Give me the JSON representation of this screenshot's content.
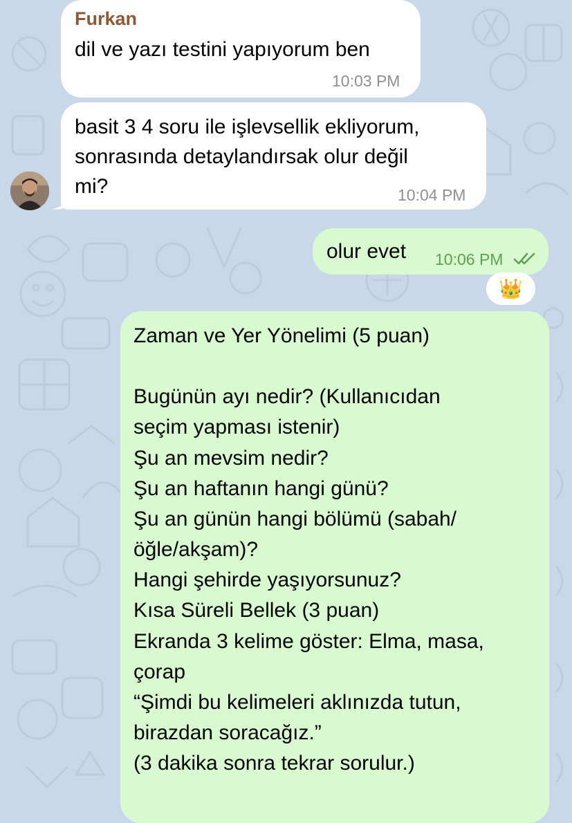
{
  "messages": [
    {
      "sender": "Furkan",
      "text": "dil ve yazı testini yapıyorum ben",
      "time": "10:03 PM"
    },
    {
      "text": "basit 3 4 soru ile işlevsellik ekliyorum,\nsonrasında detaylandırsak olur değil\nmi?",
      "time": "10:04 PM"
    },
    {
      "text": "olur evet",
      "time": "10:06 PM",
      "reaction": "👑"
    },
    {
      "text": "Zaman ve Yer Yönelimi (5 puan)\n\nBugünün ayı nedir? (Kullanıcıdan\nseçim yapması istenir)\nŞu an mevsim nedir?\nŞu an haftanın hangi günü?\nŞu an günün hangi bölümü (sabah/\nöğle/akşam)?\nHangi şehirde yaşıyorsunuz?\nKısa Süreli Bellek (3 puan)\nEkranda 3 kelime göster: Elma, masa,\nçorap\n“Şimdi bu kelimeleri aklınızda tutun,\nbirazdan soracağız.”\n(3 dakika sonra tekrar sorulur.)"
    }
  ],
  "colors": {
    "background": "#c9d8e9",
    "incoming_bubble": "#ffffff",
    "outgoing_bubble": "#d9fad1",
    "sender_name": "#8a5a38",
    "incoming_time": "#8f8f8f",
    "outgoing_time": "#5f9f55"
  },
  "icons": {
    "read_receipt": "double-check-icon",
    "avatar": "contact-avatar"
  }
}
